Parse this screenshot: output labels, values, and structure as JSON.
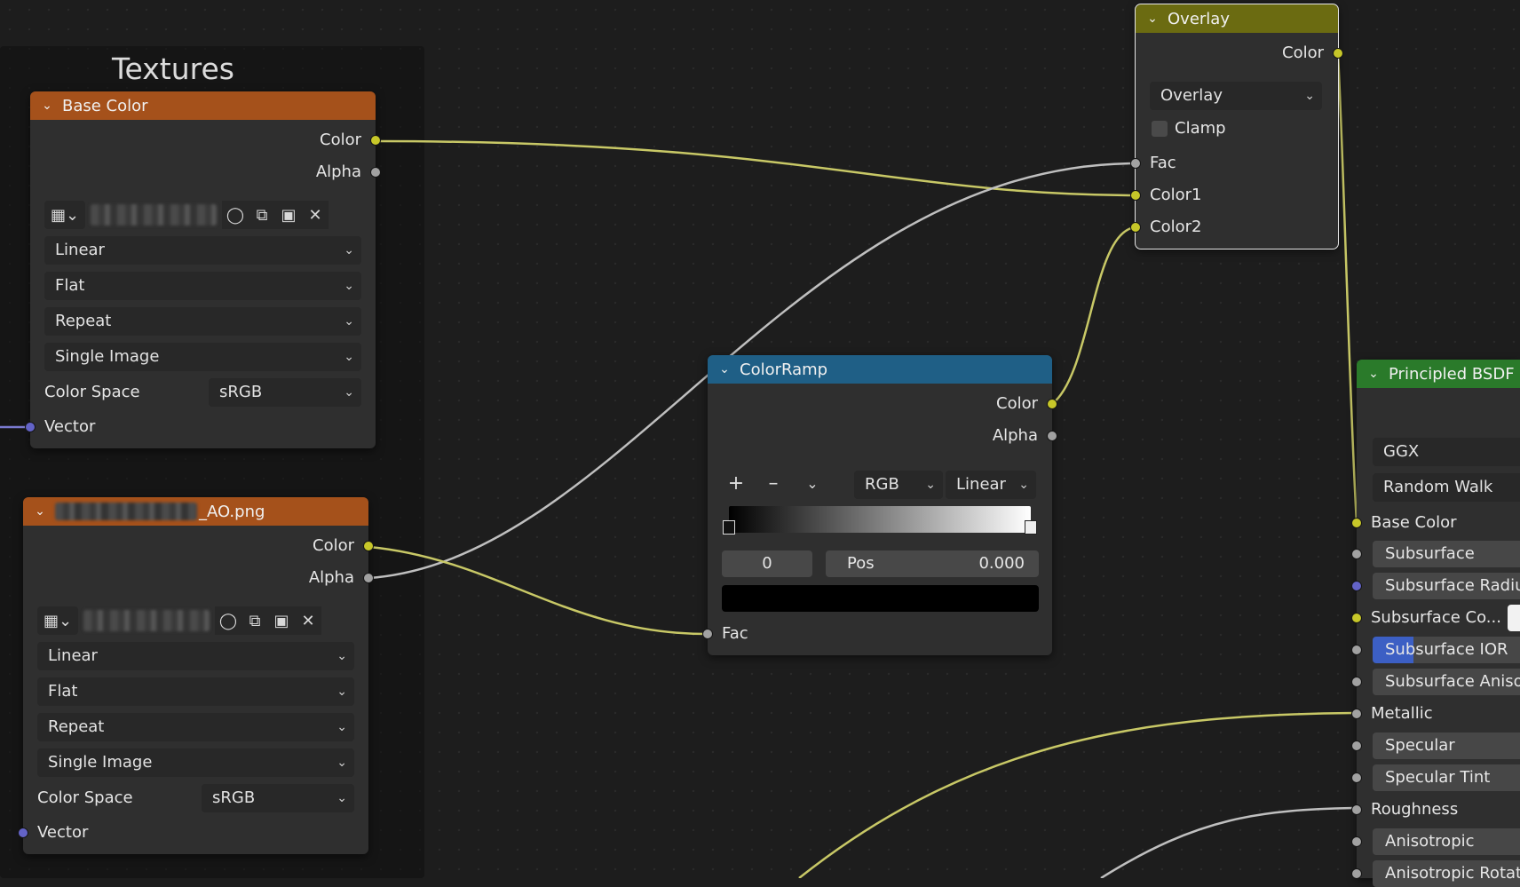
{
  "frame": {
    "label": "Textures"
  },
  "base_color_node": {
    "title": "Base Color",
    "outputs": [
      "Color",
      "Alpha"
    ],
    "interpolation": "Linear",
    "projection": "Flat",
    "extension": "Repeat",
    "source": "Single Image",
    "color_space_label": "Color Space",
    "color_space": "sRGB",
    "input_vector": "Vector"
  },
  "ao_node": {
    "title": "_AO.png",
    "outputs": [
      "Color",
      "Alpha"
    ],
    "interpolation": "Linear",
    "projection": "Flat",
    "extension": "Repeat",
    "source": "Single Image",
    "color_space_label": "Color Space",
    "color_space": "sRGB",
    "input_vector": "Vector"
  },
  "overlay_node": {
    "title": "Overlay",
    "output": "Color",
    "blend_mode": "Overlay",
    "clamp_label": "Clamp",
    "inputs": [
      "Fac",
      "Color1",
      "Color2"
    ]
  },
  "colorramp_node": {
    "title": "ColorRamp",
    "outputs": [
      "Color",
      "Alpha"
    ],
    "color_mode": "RGB",
    "interpolation": "Linear",
    "stop_index": "0",
    "pos_label": "Pos",
    "pos_value": "0.000",
    "input_fac": "Fac"
  },
  "principled_node": {
    "title": "Principled BSDF",
    "distribution": "GGX",
    "subsurface_method": "Random Walk",
    "inputs": [
      "Base Color",
      "Subsurface",
      "Subsurface Radius",
      "Subsurface Co...",
      "Subsurface IOR",
      "Subsurface Aniso",
      "Metallic",
      "Specular",
      "Specular Tint",
      "Roughness",
      "Anisotropic",
      "Anisotropic Rotati"
    ]
  },
  "colors": {
    "image_header": "#a5511b",
    "overlay_header": "#6b6b11",
    "colorramp_header": "#1f5f86",
    "principled_header": "#2a7a2a",
    "socket_yellow": "#c7c729",
    "socket_grey": "#a1a1a1",
    "socket_purple": "#6363c7",
    "highlight_blue": "#3c5fc4"
  }
}
